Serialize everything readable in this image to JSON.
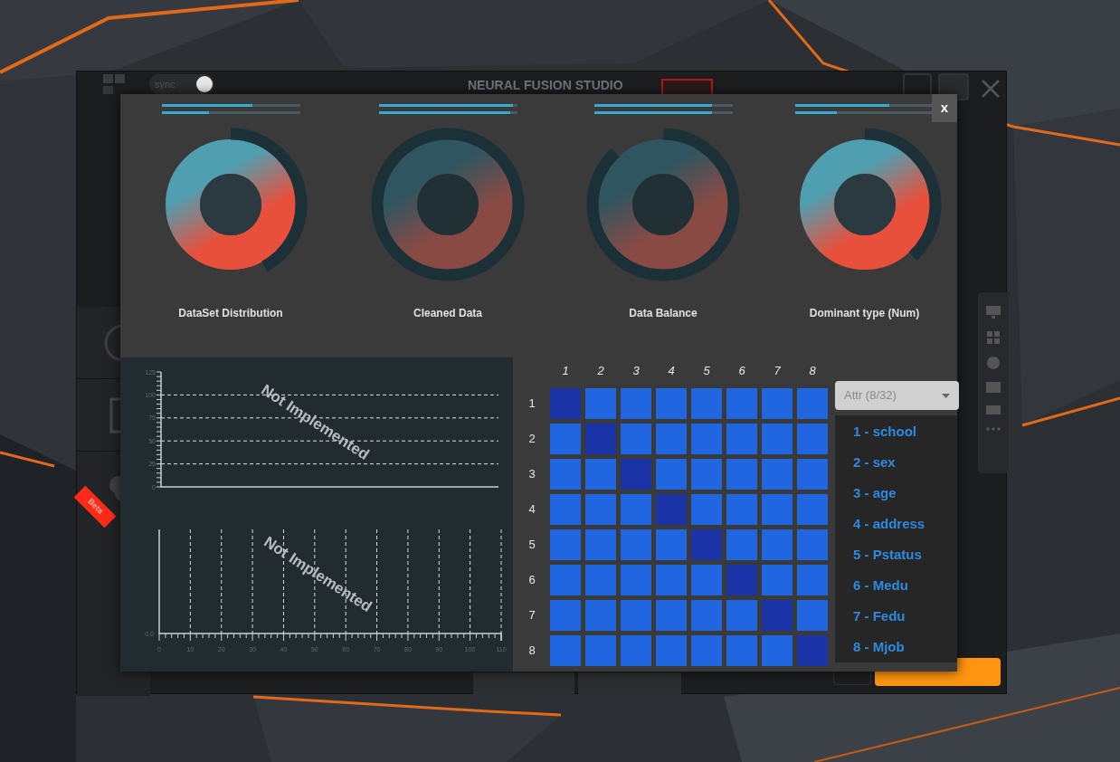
{
  "background_window": {
    "title": "NEURAL FUSION STUDIO",
    "sync_label": "sync",
    "ribbon": "Beta"
  },
  "dialog": {
    "close": "x",
    "gauges": [
      {
        "label": "DataSet Distribution",
        "kind": "bright",
        "bars": [
          {
            "level": 0.66
          },
          {
            "level": 0.34
          }
        ]
      },
      {
        "label": "Cleaned Data",
        "kind": "dim",
        "bars": [
          {
            "level": 0.97
          },
          {
            "level": 0.95
          }
        ]
      },
      {
        "label": "Data Balance",
        "kind": "dim",
        "bars": [
          {
            "level": 0.85
          },
          {
            "level": 0.85
          }
        ]
      },
      {
        "label": "Dominant type (Num)",
        "kind": "bright",
        "bars": [
          {
            "level": 0.68
          },
          {
            "level": 0.3
          }
        ]
      }
    ],
    "charts": [
      {
        "message": "Not Implemented",
        "y_ticks": [
          "125",
          "100",
          "75",
          "50",
          "25",
          "0"
        ]
      },
      {
        "message": "Not Implemented",
        "y_ticks": [
          "0.0"
        ],
        "x_ticks": [
          "0",
          "10",
          "20",
          "30",
          "40",
          "50",
          "60",
          "70",
          "80",
          "90",
          "100",
          "110"
        ]
      }
    ],
    "matrix": {
      "columns": [
        "1",
        "2",
        "3",
        "4",
        "5",
        "6",
        "7",
        "8"
      ],
      "rows": [
        {
          "label": "1",
          "highlighted": [
            true,
            false,
            false,
            false,
            false,
            false,
            false,
            false
          ]
        },
        {
          "label": "2",
          "highlighted": [
            false,
            true,
            false,
            false,
            false,
            false,
            false,
            false
          ]
        },
        {
          "label": "3",
          "highlighted": [
            false,
            false,
            true,
            false,
            false,
            false,
            false,
            false
          ]
        },
        {
          "label": "4",
          "highlighted": [
            false,
            false,
            false,
            true,
            false,
            false,
            false,
            false
          ]
        },
        {
          "label": "5",
          "highlighted": [
            false,
            false,
            false,
            false,
            true,
            false,
            false,
            false
          ]
        },
        {
          "label": "6",
          "highlighted": [
            false,
            false,
            false,
            false,
            false,
            true,
            false,
            false
          ]
        },
        {
          "label": "7",
          "highlighted": [
            false,
            false,
            false,
            false,
            false,
            false,
            true,
            false
          ]
        },
        {
          "label": "8",
          "highlighted": [
            false,
            false,
            false,
            false,
            false,
            false,
            false,
            true
          ]
        }
      ]
    },
    "attribute_select": {
      "value": "Attr (8/32)",
      "options": [
        {
          "label": "1 - school"
        },
        {
          "label": "2 - sex"
        },
        {
          "label": "3 - age"
        },
        {
          "label": "4 - address"
        },
        {
          "label": "5 - Pstatus"
        },
        {
          "label": "6 - Medu"
        },
        {
          "label": "7 - Fedu"
        },
        {
          "label": "8 - Mjob"
        }
      ]
    }
  }
}
